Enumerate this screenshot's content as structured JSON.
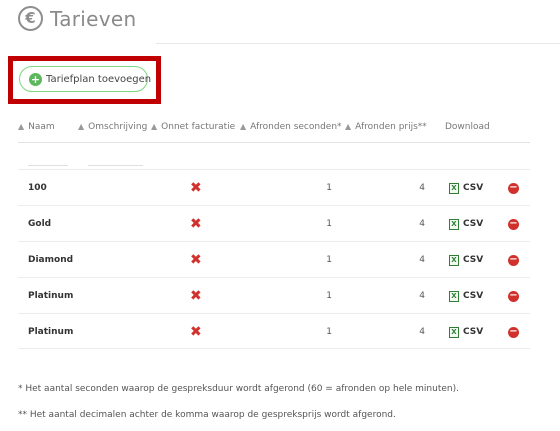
{
  "header": {
    "title": "Tarieven",
    "icon": "euro-icon"
  },
  "toolbar": {
    "add_label": "Tariefplan toevoegen",
    "add_icon": "plus-circle-icon"
  },
  "table": {
    "columns": {
      "name": "Naam",
      "description": "Omschrijving",
      "billing": "Onnet facturatie",
      "round_seconds": "Afronden seconden*",
      "round_price": "Afronden prijs**",
      "download": "Download"
    },
    "rows": [
      {
        "name": "100",
        "onnet": false,
        "round_seconds": "1",
        "round_price": "4",
        "download": "CSV"
      },
      {
        "name": "Gold",
        "onnet": false,
        "round_seconds": "1",
        "round_price": "4",
        "download": "CSV"
      },
      {
        "name": "Diamond",
        "onnet": false,
        "round_seconds": "1",
        "round_price": "4",
        "download": "CSV"
      },
      {
        "name": "Platinum",
        "onnet": false,
        "round_seconds": "1",
        "round_price": "4",
        "download": "CSV"
      },
      {
        "name": "Platinum",
        "onnet": false,
        "round_seconds": "1",
        "round_price": "4",
        "download": "CSV"
      }
    ]
  },
  "footnotes": {
    "seconds": "* Het aantal seconden waarop de gespreksduur wordt afgerond (60 = afronden op hele minuten).",
    "price": "** Het aantal decimalen achter de komma waarop de gespreksprijs wordt afgerond."
  },
  "colors": {
    "accent_green": "#5cb85c",
    "danger_red": "#d0312d",
    "highlight_red": "#c00000"
  }
}
